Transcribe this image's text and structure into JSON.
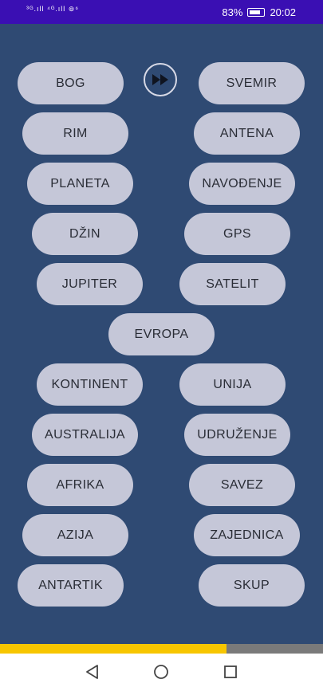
{
  "status_bar": {
    "signal_text": "³ᴳ.ıll ⁴ᴳ.ıll ⊚⁶",
    "battery_percent": "83%",
    "time": "20:02"
  },
  "game": {
    "progress": 0.7,
    "buttons": {
      "left": [
        "BOG",
        "RIM",
        "PLANETA",
        "DŽIN",
        "JUPITER",
        "KONTINENT",
        "AUSTRALIJA",
        "AFRIKA",
        "AZIJA",
        "ANTARTIK"
      ],
      "right": [
        "SVEMIR",
        "ANTENA",
        "NAVOĐENJE",
        "GPS",
        "SATELIT",
        "UNIJA",
        "UDRUŽENJE",
        "SAVEZ",
        "ZAJEDNICA",
        "SKUP"
      ],
      "center": "EVROPA"
    }
  },
  "icons": {
    "skip": "fast-forward-icon",
    "nav_back": "back-triangle-icon",
    "nav_home": "home-circle-icon",
    "nav_recents": "recents-square-icon"
  },
  "colors": {
    "status_bar": "#3a0fb3",
    "background": "#2f4a73",
    "button": "#c5c7d8",
    "progress": "#f7c600"
  }
}
